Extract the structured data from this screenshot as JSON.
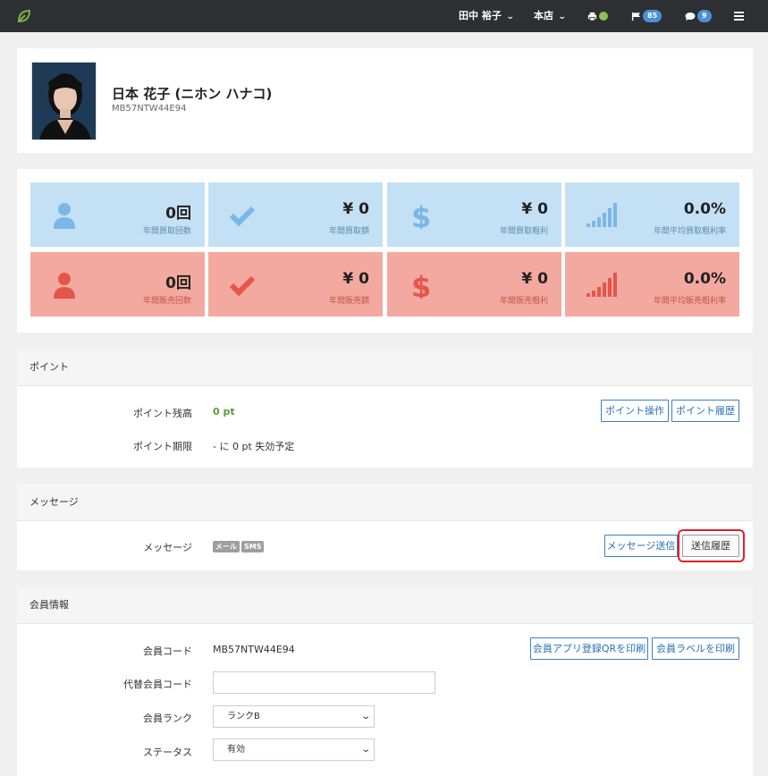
{
  "topbar": {
    "user_name": "田中 裕子",
    "store": "本店",
    "flag_count": "85",
    "message_count": "9"
  },
  "profile": {
    "name": "日本 花子 (ニホン ハナコ)",
    "member_code": "MB57NTW44E94"
  },
  "stats": {
    "buy": [
      {
        "value": "0回",
        "label": "年間買取回数",
        "icon": "user-icon"
      },
      {
        "value": "¥ 0",
        "label": "年間買取額",
        "icon": "check-icon"
      },
      {
        "value": "¥ 0",
        "label": "年間買取粗利",
        "icon": "dollar-icon"
      },
      {
        "value": "0.0%",
        "label": "年間平均買取粗利率",
        "icon": "signal-bars-icon"
      }
    ],
    "sell": [
      {
        "value": "0回",
        "label": "年間販売回数",
        "icon": "user-icon"
      },
      {
        "value": "¥ 0",
        "label": "年間販売額",
        "icon": "check-icon"
      },
      {
        "value": "¥ 0",
        "label": "年間販売粗利",
        "icon": "dollar-icon"
      },
      {
        "value": "0.0%",
        "label": "年間平均販売粗利率",
        "icon": "signal-bars-icon"
      }
    ]
  },
  "points": {
    "title": "ポイント",
    "balance_label": "ポイント残高",
    "balance_value": "0 pt",
    "expiry_label": "ポイント期限",
    "expiry_value": "- に 0 pt 失効予定",
    "operate_button": "ポイント操作",
    "history_button": "ポイント履歴"
  },
  "messages": {
    "title": "メッセージ",
    "label": "メッセージ",
    "tag_mail": "メール",
    "tag_sms": "SMS",
    "send_button": "メッセージ送信",
    "history_button": "送信履歴"
  },
  "member_info": {
    "title": "会員情報",
    "code_label": "会員コード",
    "code_value": "MB57NTW44E94",
    "alt_code_label": "代替会員コード",
    "alt_code_value": "",
    "rank_label": "会員ランク",
    "rank_value": "ランクB",
    "status_label": "ステータス",
    "status_value": "有効",
    "print_qr_button": "会員アプリ登録QRを印刷",
    "print_label_button": "会員ラベルを印刷"
  },
  "colors": {
    "topbar": "#2d2f33",
    "tile_blue": "#c4e0f5",
    "tile_red": "#f3a9a0",
    "accent": "#3a80c2",
    "highlight": "#e0202c"
  }
}
